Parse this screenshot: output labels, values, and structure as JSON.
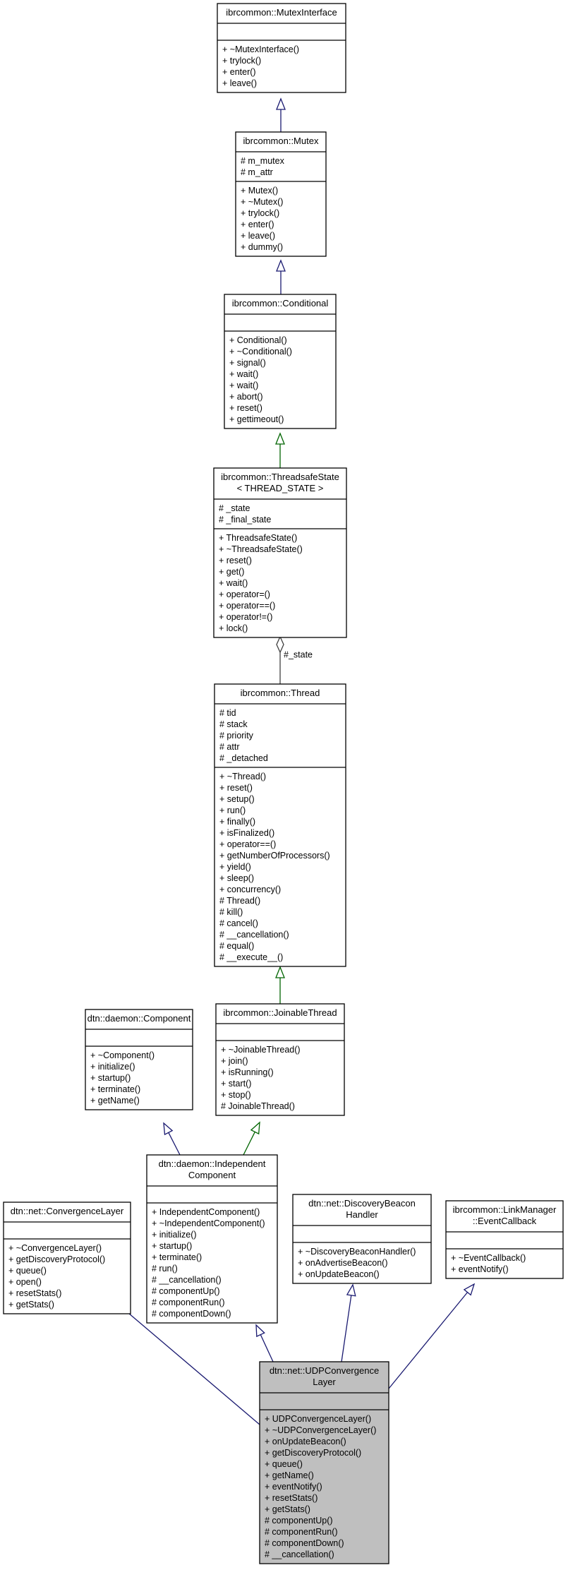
{
  "diagram": {
    "type": "uml-class-inheritance-graph",
    "focus_class": "udp",
    "classes": [
      {
        "id": "mutexinterface",
        "title": [
          "ibrcommon::MutexInterface"
        ],
        "attributes": [],
        "methods": [
          "+ ~MutexInterface()",
          "+ trylock()",
          "+ enter()",
          "+ leave()"
        ]
      },
      {
        "id": "mutex",
        "title": [
          "ibrcommon::Mutex"
        ],
        "attributes": [
          "# m_mutex",
          "# m_attr"
        ],
        "methods": [
          "+ Mutex()",
          "+ ~Mutex()",
          "+ trylock()",
          "+ enter()",
          "+ leave()",
          "+ dummy()"
        ]
      },
      {
        "id": "conditional",
        "title": [
          "ibrcommon::Conditional"
        ],
        "attributes": [],
        "methods": [
          "+ Conditional()",
          "+ ~Conditional()",
          "+ signal()",
          "+ wait()",
          "+ wait()",
          "+ abort()",
          "+ reset()",
          "+ gettimeout()"
        ]
      },
      {
        "id": "threadsafestate",
        "title": [
          "ibrcommon::ThreadsafeState",
          "< THREAD_STATE >"
        ],
        "attributes": [
          "# _state",
          "# _final_state"
        ],
        "methods": [
          "+ ThreadsafeState()",
          "+ ~ThreadsafeState()",
          "+ reset()",
          "+ get()",
          "+ wait()",
          "+ operator=()",
          "+ operator==()",
          "+ operator!=()",
          "+ lock()"
        ]
      },
      {
        "id": "thread",
        "title": [
          "ibrcommon::Thread"
        ],
        "attributes": [
          "# tid",
          "# stack",
          "# priority",
          "# attr",
          "# _detached"
        ],
        "methods": [
          "+ ~Thread()",
          "+ reset()",
          "+ setup()",
          "+ run()",
          "+ finally()",
          "+ isFinalized()",
          "+ operator==()",
          "+ getNumberOfProcessors()",
          "+ yield()",
          "+ sleep()",
          "+ concurrency()",
          "# Thread()",
          "# kill()",
          "# cancel()",
          "# __cancellation()",
          "# equal()",
          "# __execute__()"
        ]
      },
      {
        "id": "component",
        "title": [
          "dtn::daemon::Component"
        ],
        "attributes": [],
        "methods": [
          "+ ~Component()",
          "+ initialize()",
          "+ startup()",
          "+ terminate()",
          "+ getName()"
        ]
      },
      {
        "id": "joinablethread",
        "title": [
          "ibrcommon::JoinableThread"
        ],
        "attributes": [],
        "methods": [
          "+ ~JoinableThread()",
          "+ join()",
          "+ isRunning()",
          "+ start()",
          "+ stop()",
          "# JoinableThread()"
        ]
      },
      {
        "id": "convergencelayer",
        "title": [
          "dtn::net::ConvergenceLayer"
        ],
        "attributes": [],
        "methods": [
          "+ ~ConvergenceLayer()",
          "+ getDiscoveryProtocol()",
          "+ queue()",
          "+ open()",
          "+ resetStats()",
          "+ getStats()"
        ]
      },
      {
        "id": "independentcomponent",
        "title": [
          "dtn::daemon::Independent",
          "Component"
        ],
        "attributes": [],
        "methods": [
          "+ IndependentComponent()",
          "+ ~IndependentComponent()",
          "+ initialize()",
          "+ startup()",
          "+ terminate()",
          "# run()",
          "# __cancellation()",
          "# componentUp()",
          "# componentRun()",
          "# componentDown()"
        ]
      },
      {
        "id": "discoverybeaconhandler",
        "title": [
          "dtn::net::DiscoveryBeacon",
          "Handler"
        ],
        "attributes": [],
        "methods": [
          "+ ~DiscoveryBeaconHandler()",
          "+ onAdvertiseBeacon()",
          "+ onUpdateBeacon()"
        ]
      },
      {
        "id": "eventcallback",
        "title": [
          "ibrcommon::LinkManager",
          "::EventCallback"
        ],
        "attributes": [],
        "methods": [
          "+ ~EventCallback()",
          "+ eventNotify()"
        ]
      },
      {
        "id": "udp",
        "title": [
          "dtn::net::UDPConvergence",
          "Layer"
        ],
        "attributes": [],
        "methods": [
          "+ UDPConvergenceLayer()",
          "+ ~UDPConvergenceLayer()",
          "+ onUpdateBeacon()",
          "+ getDiscoveryProtocol()",
          "+ queue()",
          "+ getName()",
          "+ eventNotify()",
          "+ resetStats()",
          "+ getStats()",
          "# componentUp()",
          "# componentRun()",
          "# componentDown()",
          "# __cancellation()"
        ]
      }
    ],
    "edges": [
      {
        "from": "mutex",
        "to": "mutexinterface",
        "kind": "public-inheritance",
        "label": ""
      },
      {
        "from": "conditional",
        "to": "mutex",
        "kind": "public-inheritance",
        "label": ""
      },
      {
        "from": "threadsafestate",
        "to": "conditional",
        "kind": "protected-inheritance",
        "label": ""
      },
      {
        "from": "thread",
        "to": "threadsafestate",
        "kind": "usage",
        "label": "#_state"
      },
      {
        "from": "joinablethread",
        "to": "thread",
        "kind": "protected-inheritance",
        "label": ""
      },
      {
        "from": "independentcomponent",
        "to": "component",
        "kind": "public-inheritance",
        "label": ""
      },
      {
        "from": "independentcomponent",
        "to": "joinablethread",
        "kind": "protected-inheritance",
        "label": ""
      },
      {
        "from": "udp",
        "to": "convergencelayer",
        "kind": "public-inheritance",
        "label": ""
      },
      {
        "from": "udp",
        "to": "independentcomponent",
        "kind": "public-inheritance",
        "label": ""
      },
      {
        "from": "udp",
        "to": "discoverybeaconhandler",
        "kind": "public-inheritance",
        "label": ""
      },
      {
        "from": "udp",
        "to": "eventcallback",
        "kind": "public-inheritance",
        "label": ""
      }
    ]
  }
}
